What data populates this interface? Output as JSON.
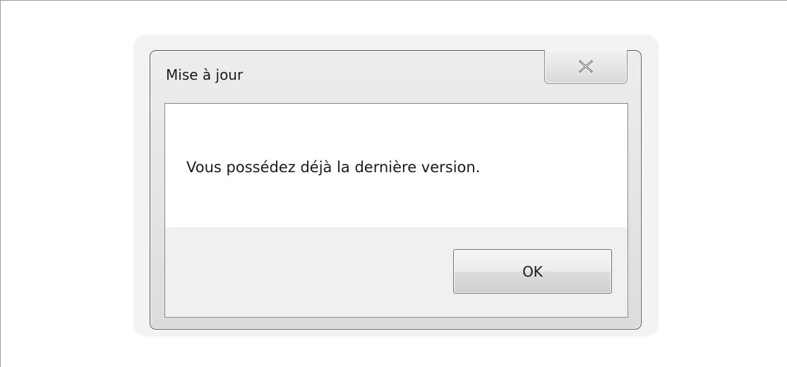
{
  "dialog": {
    "title": "Mise à jour",
    "message": "Vous possédez déjà la dernière version.",
    "ok_label": "OK",
    "close_icon": "close-icon"
  },
  "colors": {
    "background": "#ffffff",
    "window_frame": "#e6e6e6",
    "client_area": "#f0f0f0",
    "message_area": "#ffffff",
    "border": "#5a5a5a"
  }
}
